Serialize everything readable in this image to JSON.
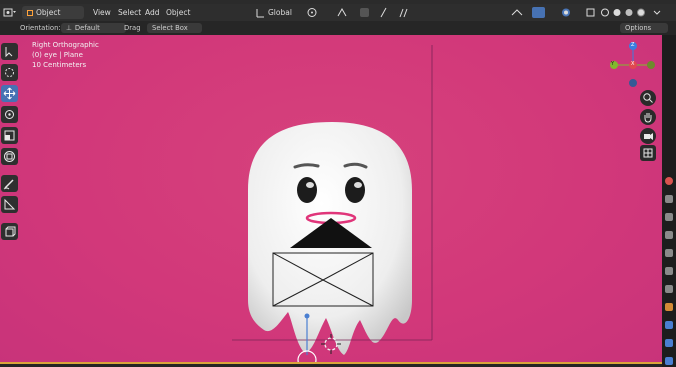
{
  "header": {
    "mode_label": "Object Mode",
    "menu_view": "View",
    "menu_select": "Select",
    "menu_add": "Add",
    "menu_object": "Object",
    "transform_orientation": "Global"
  },
  "tool_options": {
    "orientation_label": "Orientation:",
    "orientation_value": "Default",
    "drag_label": "Drag",
    "drag_value": "Select Box",
    "options_label": "Options"
  },
  "viewport": {
    "view_name": "Right Orthographic",
    "object_info": "(0) eye | Plane",
    "scale_info": "10 Centimeters",
    "background_color": "#d63a7a"
  },
  "gizmo": {
    "y_label": "Y",
    "z_label": "Z",
    "x_label": "X"
  }
}
